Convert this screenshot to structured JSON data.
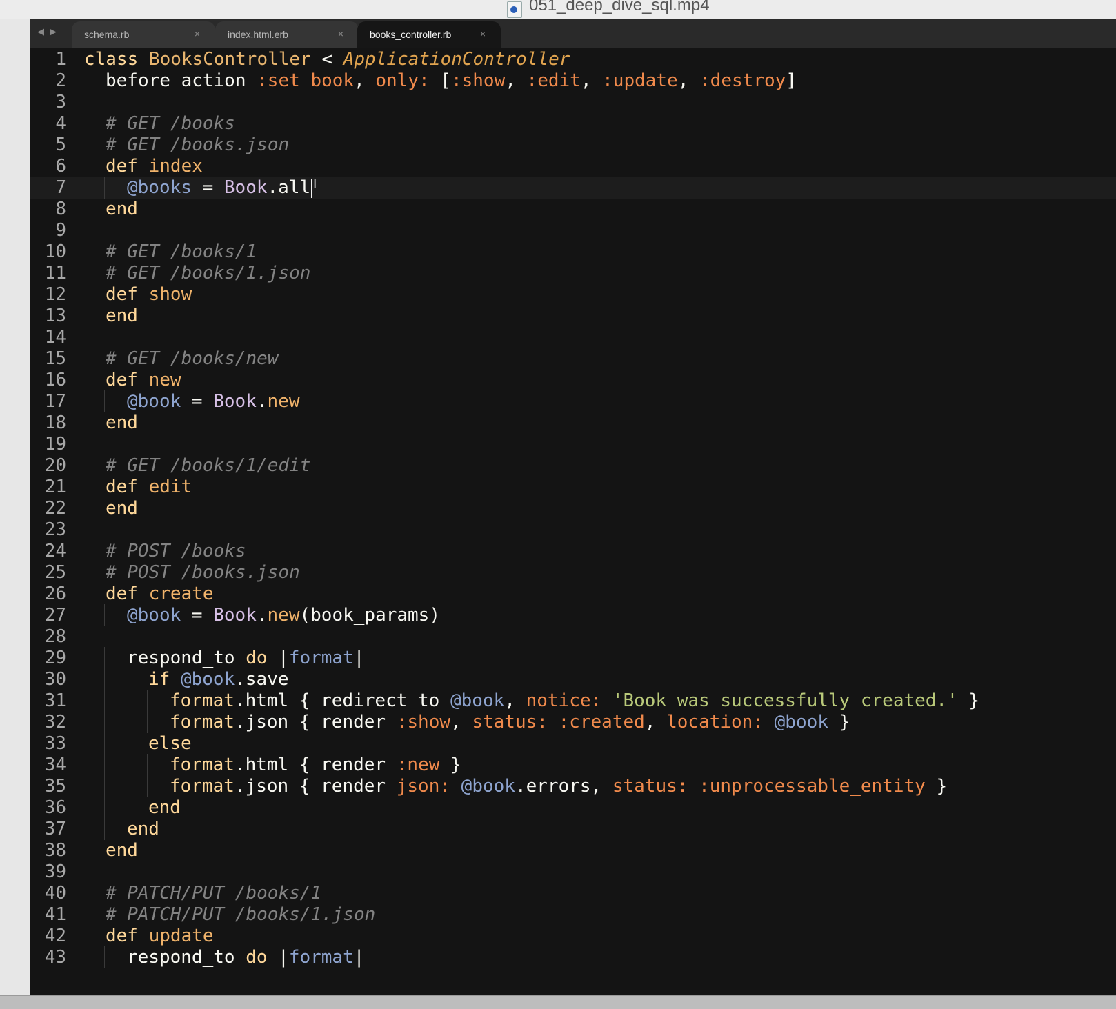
{
  "window": {
    "title": "051_deep_dive_sql.mp4",
    "file_icon": "quicktime-file-icon"
  },
  "tabs": [
    {
      "label": "schema.rb",
      "active": false
    },
    {
      "label": "index.html.erb",
      "active": false
    },
    {
      "label": "books_controller.rb",
      "active": true
    }
  ],
  "tab_close_glyph": "×",
  "nav": {
    "back": "◀",
    "forward": "▶"
  },
  "editor": {
    "current_line": 7,
    "lines": [
      {
        "n": "1",
        "indent": 0,
        "tokens": [
          [
            "keyword",
            "class "
          ],
          [
            "class",
            "BooksController"
          ],
          [
            "text",
            " < "
          ],
          [
            "inherit",
            "ApplicationController"
          ]
        ]
      },
      {
        "n": "2",
        "indent": 1,
        "tokens": [
          [
            "text",
            "before_action "
          ],
          [
            "symbol",
            ":set_book"
          ],
          [
            "text",
            ", "
          ],
          [
            "symbol",
            "only:"
          ],
          [
            "text",
            " ["
          ],
          [
            "symbol",
            ":show"
          ],
          [
            "text",
            ", "
          ],
          [
            "symbol",
            ":edit"
          ],
          [
            "text",
            ", "
          ],
          [
            "symbol",
            ":update"
          ],
          [
            "text",
            ", "
          ],
          [
            "symbol",
            ":destroy"
          ],
          [
            "text",
            "]"
          ]
        ]
      },
      {
        "n": "3",
        "indent": 0,
        "tokens": []
      },
      {
        "n": "4",
        "indent": 1,
        "tokens": [
          [
            "comment",
            "# GET /books"
          ]
        ]
      },
      {
        "n": "5",
        "indent": 1,
        "tokens": [
          [
            "comment",
            "# GET /books.json"
          ]
        ]
      },
      {
        "n": "6",
        "indent": 1,
        "tokens": [
          [
            "keyword",
            "def "
          ],
          [
            "fn",
            "index"
          ]
        ]
      },
      {
        "n": "7",
        "indent": 2,
        "tokens": [
          [
            "ivar",
            "@books"
          ],
          [
            "text",
            " = "
          ],
          [
            "const",
            "Book"
          ],
          [
            "text",
            ".all"
          ]
        ]
      },
      {
        "n": "8",
        "indent": 1,
        "tokens": [
          [
            "keyword",
            "end"
          ]
        ]
      },
      {
        "n": "9",
        "indent": 0,
        "tokens": []
      },
      {
        "n": "10",
        "indent": 1,
        "tokens": [
          [
            "comment",
            "# GET /books/1"
          ]
        ]
      },
      {
        "n": "11",
        "indent": 1,
        "tokens": [
          [
            "comment",
            "# GET /books/1.json"
          ]
        ]
      },
      {
        "n": "12",
        "indent": 1,
        "tokens": [
          [
            "keyword",
            "def "
          ],
          [
            "fn",
            "show"
          ]
        ]
      },
      {
        "n": "13",
        "indent": 1,
        "tokens": [
          [
            "keyword",
            "end"
          ]
        ]
      },
      {
        "n": "14",
        "indent": 0,
        "tokens": []
      },
      {
        "n": "15",
        "indent": 1,
        "tokens": [
          [
            "comment",
            "# GET /books/new"
          ]
        ]
      },
      {
        "n": "16",
        "indent": 1,
        "tokens": [
          [
            "keyword",
            "def "
          ],
          [
            "fn",
            "new"
          ]
        ]
      },
      {
        "n": "17",
        "indent": 2,
        "tokens": [
          [
            "ivar",
            "@book"
          ],
          [
            "text",
            " = "
          ],
          [
            "const",
            "Book"
          ],
          [
            "text",
            "."
          ],
          [
            "fn",
            "new"
          ]
        ]
      },
      {
        "n": "18",
        "indent": 1,
        "tokens": [
          [
            "keyword",
            "end"
          ]
        ]
      },
      {
        "n": "19",
        "indent": 0,
        "tokens": []
      },
      {
        "n": "20",
        "indent": 1,
        "tokens": [
          [
            "comment",
            "# GET /books/1/edit"
          ]
        ]
      },
      {
        "n": "21",
        "indent": 1,
        "tokens": [
          [
            "keyword",
            "def "
          ],
          [
            "fn",
            "edit"
          ]
        ]
      },
      {
        "n": "22",
        "indent": 1,
        "tokens": [
          [
            "keyword",
            "end"
          ]
        ]
      },
      {
        "n": "23",
        "indent": 0,
        "tokens": []
      },
      {
        "n": "24",
        "indent": 1,
        "tokens": [
          [
            "comment",
            "# POST /books"
          ]
        ]
      },
      {
        "n": "25",
        "indent": 1,
        "tokens": [
          [
            "comment",
            "# POST /books.json"
          ]
        ]
      },
      {
        "n": "26",
        "indent": 1,
        "tokens": [
          [
            "keyword",
            "def "
          ],
          [
            "fn",
            "create"
          ]
        ]
      },
      {
        "n": "27",
        "indent": 2,
        "tokens": [
          [
            "ivar",
            "@book"
          ],
          [
            "text",
            " = "
          ],
          [
            "const",
            "Book"
          ],
          [
            "text",
            "."
          ],
          [
            "fn",
            "new"
          ],
          [
            "text",
            "(book_params)"
          ]
        ]
      },
      {
        "n": "28",
        "indent": 0,
        "tokens": []
      },
      {
        "n": "29",
        "indent": 2,
        "tokens": [
          [
            "text",
            "respond_to "
          ],
          [
            "keyword",
            "do"
          ],
          [
            "text",
            " |"
          ],
          [
            "ivar",
            "format"
          ],
          [
            "text",
            "|"
          ]
        ]
      },
      {
        "n": "30",
        "indent": 3,
        "tokens": [
          [
            "keyword",
            "if "
          ],
          [
            "ivar",
            "@book"
          ],
          [
            "text",
            ".save"
          ]
        ]
      },
      {
        "n": "31",
        "indent": 4,
        "tokens": [
          [
            "keyword",
            "format"
          ],
          [
            "text",
            ".html { redirect_to "
          ],
          [
            "ivar",
            "@book"
          ],
          [
            "text",
            ", "
          ],
          [
            "symbol",
            "notice:"
          ],
          [
            "text",
            " "
          ],
          [
            "string",
            "'Book was successfully created.'"
          ],
          [
            "text",
            " }"
          ]
        ]
      },
      {
        "n": "32",
        "indent": 4,
        "tokens": [
          [
            "keyword",
            "format"
          ],
          [
            "text",
            ".json { render "
          ],
          [
            "symbol",
            ":show"
          ],
          [
            "text",
            ", "
          ],
          [
            "symbol",
            "status:"
          ],
          [
            "text",
            " "
          ],
          [
            "symbol",
            ":created"
          ],
          [
            "text",
            ", "
          ],
          [
            "symbol",
            "location:"
          ],
          [
            "text",
            " "
          ],
          [
            "ivar",
            "@book"
          ],
          [
            "text",
            " }"
          ]
        ]
      },
      {
        "n": "33",
        "indent": 3,
        "tokens": [
          [
            "keyword",
            "else"
          ]
        ]
      },
      {
        "n": "34",
        "indent": 4,
        "tokens": [
          [
            "keyword",
            "format"
          ],
          [
            "text",
            ".html { render "
          ],
          [
            "symbol",
            ":new"
          ],
          [
            "text",
            " }"
          ]
        ]
      },
      {
        "n": "35",
        "indent": 4,
        "tokens": [
          [
            "keyword",
            "format"
          ],
          [
            "text",
            ".json { render "
          ],
          [
            "symbol",
            "json:"
          ],
          [
            "text",
            " "
          ],
          [
            "ivar",
            "@book"
          ],
          [
            "text",
            ".errors, "
          ],
          [
            "symbol",
            "status:"
          ],
          [
            "text",
            " "
          ],
          [
            "symbol",
            ":unprocessable_entity"
          ],
          [
            "text",
            " }"
          ]
        ]
      },
      {
        "n": "36",
        "indent": 3,
        "tokens": [
          [
            "keyword",
            "end"
          ]
        ]
      },
      {
        "n": "37",
        "indent": 2,
        "tokens": [
          [
            "keyword",
            "end"
          ]
        ]
      },
      {
        "n": "38",
        "indent": 1,
        "tokens": [
          [
            "keyword",
            "end"
          ]
        ]
      },
      {
        "n": "39",
        "indent": 0,
        "tokens": []
      },
      {
        "n": "40",
        "indent": 1,
        "tokens": [
          [
            "comment",
            "# PATCH/PUT /books/1"
          ]
        ]
      },
      {
        "n": "41",
        "indent": 1,
        "tokens": [
          [
            "comment",
            "# PATCH/PUT /books/1.json"
          ]
        ]
      },
      {
        "n": "42",
        "indent": 1,
        "tokens": [
          [
            "keyword",
            "def "
          ],
          [
            "fn",
            "update"
          ]
        ]
      },
      {
        "n": "43",
        "indent": 2,
        "tokens": [
          [
            "text",
            "respond_to "
          ],
          [
            "keyword",
            "do"
          ],
          [
            "text",
            " |"
          ],
          [
            "ivar",
            "format"
          ],
          [
            "text",
            "|"
          ]
        ]
      }
    ]
  }
}
